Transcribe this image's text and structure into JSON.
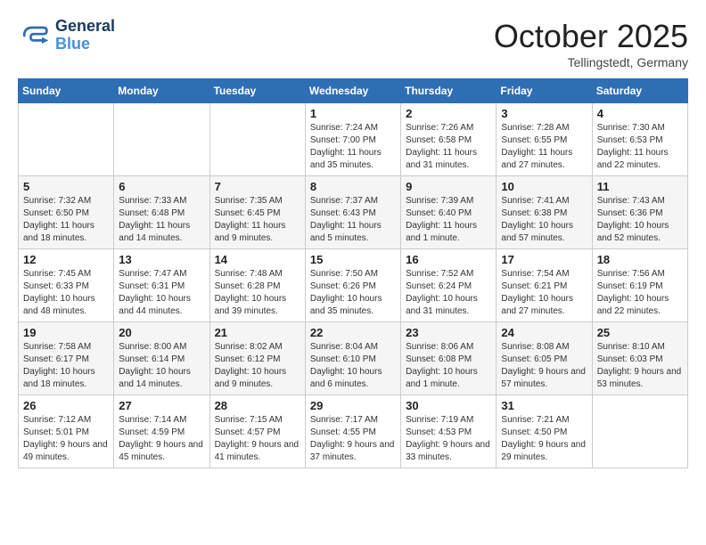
{
  "header": {
    "logo_line1": "General",
    "logo_line2": "Blue",
    "month": "October 2025",
    "location": "Tellingstedt, Germany"
  },
  "weekdays": [
    "Sunday",
    "Monday",
    "Tuesday",
    "Wednesday",
    "Thursday",
    "Friday",
    "Saturday"
  ],
  "weeks": [
    [
      {
        "day": "",
        "info": ""
      },
      {
        "day": "",
        "info": ""
      },
      {
        "day": "",
        "info": ""
      },
      {
        "day": "1",
        "info": "Sunrise: 7:24 AM\nSunset: 7:00 PM\nDaylight: 11 hours and 35 minutes."
      },
      {
        "day": "2",
        "info": "Sunrise: 7:26 AM\nSunset: 6:58 PM\nDaylight: 11 hours and 31 minutes."
      },
      {
        "day": "3",
        "info": "Sunrise: 7:28 AM\nSunset: 6:55 PM\nDaylight: 11 hours and 27 minutes."
      },
      {
        "day": "4",
        "info": "Sunrise: 7:30 AM\nSunset: 6:53 PM\nDaylight: 11 hours and 22 minutes."
      }
    ],
    [
      {
        "day": "5",
        "info": "Sunrise: 7:32 AM\nSunset: 6:50 PM\nDaylight: 11 hours and 18 minutes."
      },
      {
        "day": "6",
        "info": "Sunrise: 7:33 AM\nSunset: 6:48 PM\nDaylight: 11 hours and 14 minutes."
      },
      {
        "day": "7",
        "info": "Sunrise: 7:35 AM\nSunset: 6:45 PM\nDaylight: 11 hours and 9 minutes."
      },
      {
        "day": "8",
        "info": "Sunrise: 7:37 AM\nSunset: 6:43 PM\nDaylight: 11 hours and 5 minutes."
      },
      {
        "day": "9",
        "info": "Sunrise: 7:39 AM\nSunset: 6:40 PM\nDaylight: 11 hours and 1 minute."
      },
      {
        "day": "10",
        "info": "Sunrise: 7:41 AM\nSunset: 6:38 PM\nDaylight: 10 hours and 57 minutes."
      },
      {
        "day": "11",
        "info": "Sunrise: 7:43 AM\nSunset: 6:36 PM\nDaylight: 10 hours and 52 minutes."
      }
    ],
    [
      {
        "day": "12",
        "info": "Sunrise: 7:45 AM\nSunset: 6:33 PM\nDaylight: 10 hours and 48 minutes."
      },
      {
        "day": "13",
        "info": "Sunrise: 7:47 AM\nSunset: 6:31 PM\nDaylight: 10 hours and 44 minutes."
      },
      {
        "day": "14",
        "info": "Sunrise: 7:48 AM\nSunset: 6:28 PM\nDaylight: 10 hours and 39 minutes."
      },
      {
        "day": "15",
        "info": "Sunrise: 7:50 AM\nSunset: 6:26 PM\nDaylight: 10 hours and 35 minutes."
      },
      {
        "day": "16",
        "info": "Sunrise: 7:52 AM\nSunset: 6:24 PM\nDaylight: 10 hours and 31 minutes."
      },
      {
        "day": "17",
        "info": "Sunrise: 7:54 AM\nSunset: 6:21 PM\nDaylight: 10 hours and 27 minutes."
      },
      {
        "day": "18",
        "info": "Sunrise: 7:56 AM\nSunset: 6:19 PM\nDaylight: 10 hours and 22 minutes."
      }
    ],
    [
      {
        "day": "19",
        "info": "Sunrise: 7:58 AM\nSunset: 6:17 PM\nDaylight: 10 hours and 18 minutes."
      },
      {
        "day": "20",
        "info": "Sunrise: 8:00 AM\nSunset: 6:14 PM\nDaylight: 10 hours and 14 minutes."
      },
      {
        "day": "21",
        "info": "Sunrise: 8:02 AM\nSunset: 6:12 PM\nDaylight: 10 hours and 9 minutes."
      },
      {
        "day": "22",
        "info": "Sunrise: 8:04 AM\nSunset: 6:10 PM\nDaylight: 10 hours and 6 minutes."
      },
      {
        "day": "23",
        "info": "Sunrise: 8:06 AM\nSunset: 6:08 PM\nDaylight: 10 hours and 1 minute."
      },
      {
        "day": "24",
        "info": "Sunrise: 8:08 AM\nSunset: 6:05 PM\nDaylight: 9 hours and 57 minutes."
      },
      {
        "day": "25",
        "info": "Sunrise: 8:10 AM\nSunset: 6:03 PM\nDaylight: 9 hours and 53 minutes."
      }
    ],
    [
      {
        "day": "26",
        "info": "Sunrise: 7:12 AM\nSunset: 5:01 PM\nDaylight: 9 hours and 49 minutes."
      },
      {
        "day": "27",
        "info": "Sunrise: 7:14 AM\nSunset: 4:59 PM\nDaylight: 9 hours and 45 minutes."
      },
      {
        "day": "28",
        "info": "Sunrise: 7:15 AM\nSunset: 4:57 PM\nDaylight: 9 hours and 41 minutes."
      },
      {
        "day": "29",
        "info": "Sunrise: 7:17 AM\nSunset: 4:55 PM\nDaylight: 9 hours and 37 minutes."
      },
      {
        "day": "30",
        "info": "Sunrise: 7:19 AM\nSunset: 4:53 PM\nDaylight: 9 hours and 33 minutes."
      },
      {
        "day": "31",
        "info": "Sunrise: 7:21 AM\nSunset: 4:50 PM\nDaylight: 9 hours and 29 minutes."
      },
      {
        "day": "",
        "info": ""
      }
    ]
  ]
}
